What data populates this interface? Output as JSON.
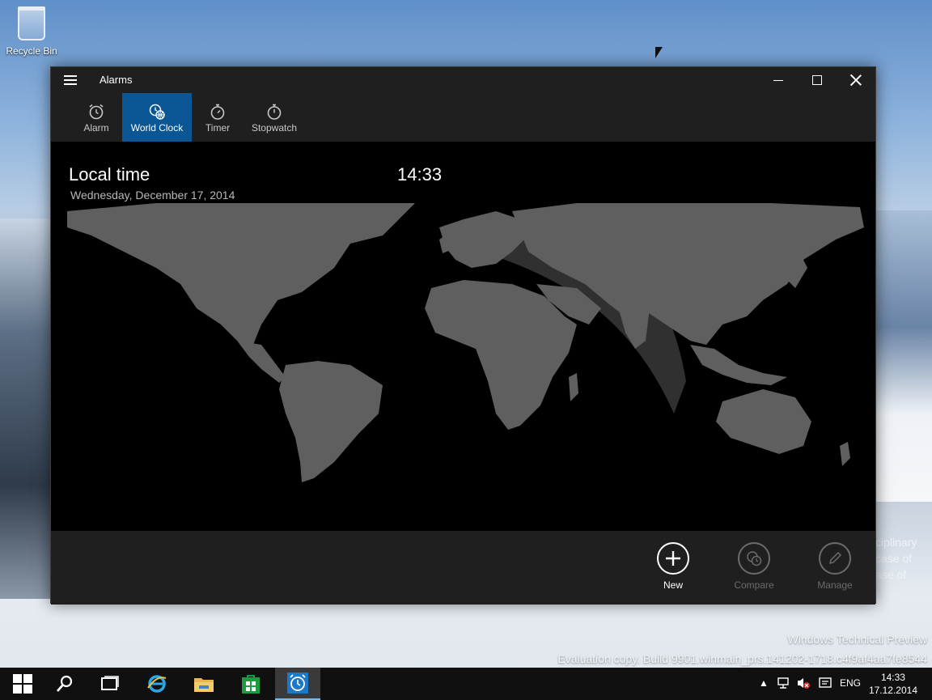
{
  "desktop": {
    "recycle_bin_label": "Recycle Bin",
    "watermark_line1": "Windows Technical Preview",
    "watermark_line2": "Evaluation copy. Build 9901.winmain_prs.141202-1718.c4f9af4aa7fe8544",
    "behind_window_text": [
      "ciplinary",
      "case of",
      "ase of"
    ]
  },
  "window": {
    "title": "Alarms",
    "tabs": [
      {
        "label": "Alarm",
        "icon": "alarm-clock-icon",
        "active": false
      },
      {
        "label": "World Clock",
        "icon": "world-clock-icon",
        "active": true
      },
      {
        "label": "Timer",
        "icon": "timer-icon",
        "active": false
      },
      {
        "label": "Stopwatch",
        "icon": "stopwatch-icon",
        "active": false
      }
    ],
    "accent_color": "#0a5593"
  },
  "world_clock": {
    "local_title": "Local time",
    "local_time": "14:33",
    "local_date": "Wednesday, December 17, 2014"
  },
  "command_bar": {
    "new_label": "New",
    "compare_label": "Compare",
    "manage_label": "Manage"
  },
  "taskbar": {
    "language": "ENG",
    "time": "14:33",
    "date": "17.12.2014"
  }
}
